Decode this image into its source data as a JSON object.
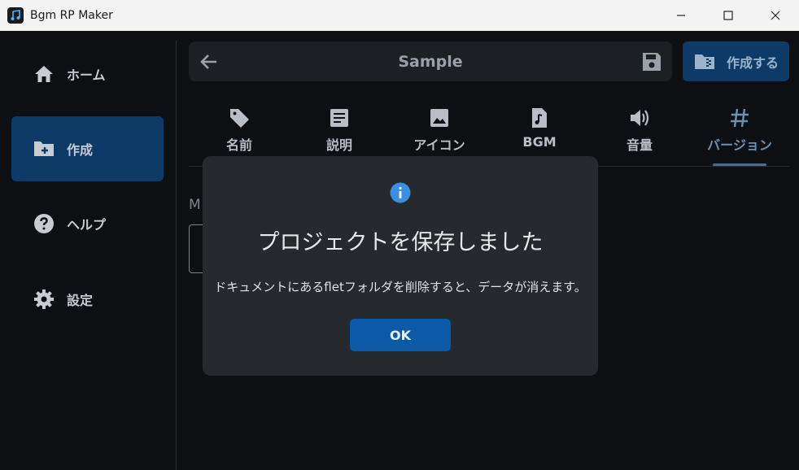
{
  "window": {
    "title": "Bgm RP Maker",
    "controls": [
      "minimize-icon",
      "maximize-icon",
      "close-icon"
    ]
  },
  "sidebar": {
    "items": [
      {
        "label": "ホーム",
        "icon": "home-icon",
        "active": false
      },
      {
        "label": "作成",
        "icon": "folder-add-icon",
        "active": true
      },
      {
        "label": "ヘルプ",
        "icon": "help-icon",
        "active": false
      },
      {
        "label": "設定",
        "icon": "gear-icon",
        "active": false
      }
    ]
  },
  "header": {
    "title": "Sample",
    "back_icon": "arrow-back-icon",
    "save_icon": "save-icon",
    "create_label": "作成する",
    "create_icon": "folder-zip-icon"
  },
  "tabs": [
    {
      "label": "名前",
      "icon": "tag-icon"
    },
    {
      "label": "説明",
      "icon": "description-icon"
    },
    {
      "label": "アイコン",
      "icon": "image-icon"
    },
    {
      "label": "BGM",
      "icon": "audio-file-icon"
    },
    {
      "label": "音量",
      "icon": "volume-icon"
    },
    {
      "label": "バージョン",
      "icon": "hash-icon",
      "active": true
    }
  ],
  "content": {
    "partial_label": "M"
  },
  "dialog": {
    "icon": "info-icon",
    "title": "プロジェクトを保存しました",
    "message": "ドキュメントにあるfletフォルダを削除すると、データが消えます。",
    "ok_label": "OK"
  },
  "colors": {
    "background": "#0d0f12",
    "accent": "#0d3a66",
    "button": "#0a5aa8",
    "info": "#3b8fe0"
  }
}
